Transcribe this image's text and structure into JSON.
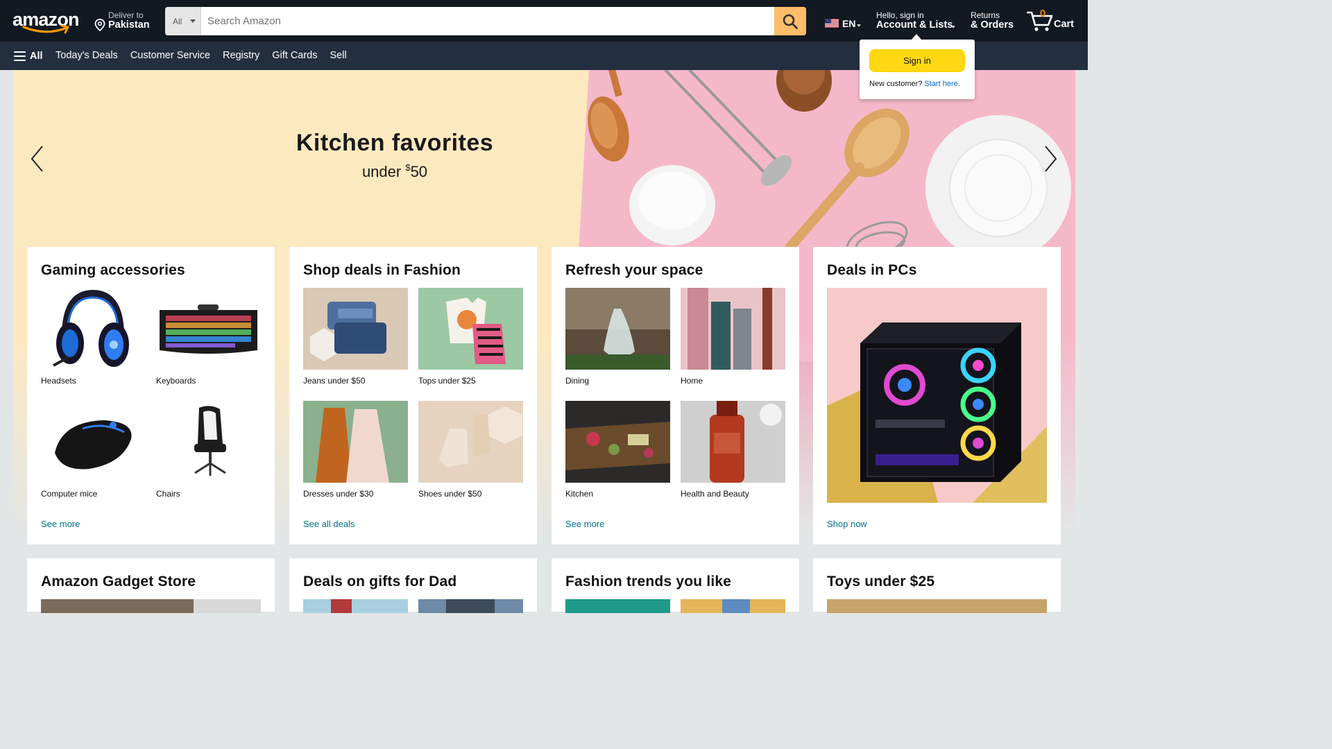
{
  "nav": {
    "logo": "amazon",
    "deliver_line1": "Deliver to",
    "deliver_line2": "Pakistan",
    "search_category": "All",
    "search_placeholder": "Search Amazon",
    "language": "EN",
    "account_line1": "Hello, sign in",
    "account_line2": "Account & Lists",
    "returns_line1": "Returns",
    "returns_line2": "& Orders",
    "cart_count": "0",
    "cart_label": "Cart",
    "all_label": "All",
    "links": [
      "Today's Deals",
      "Customer Service",
      "Registry",
      "Gift Cards",
      "Sell"
    ]
  },
  "flyout": {
    "signin_label": "Sign in",
    "new_customer": "New customer?",
    "start_here": "Start here."
  },
  "hero": {
    "title": "Kitchen favorites",
    "subtitle_prefix": "under ",
    "subtitle_currency": "$",
    "subtitle_amount": "50"
  },
  "cards": [
    {
      "title": "Gaming accessories",
      "items": [
        "Headsets",
        "Keyboards",
        "Computer mice",
        "Chairs"
      ],
      "link": "See more"
    },
    {
      "title": "Shop deals in Fashion",
      "items": [
        "Jeans under $50",
        "Tops under $25",
        "Dresses under $30",
        "Shoes under $50"
      ],
      "link": "See all deals"
    },
    {
      "title": "Refresh your space",
      "items": [
        "Dining",
        "Home",
        "Kitchen",
        "Health and Beauty"
      ],
      "link": "See more"
    },
    {
      "title": "Deals in PCs",
      "link": "Shop now"
    },
    {
      "title": "Amazon Gadget Store"
    },
    {
      "title": "Deals on gifts for Dad"
    },
    {
      "title": "Fashion trends you like"
    },
    {
      "title": "Toys under $25"
    }
  ],
  "colors": {
    "nav_top": "#131921",
    "nav_bottom": "#232f3e",
    "search_button": "#febd69",
    "signin_button": "#ffd814",
    "link": "#007185",
    "cart_count": "#f08804",
    "hero_cream": "#fde9c0",
    "hero_pink": "#f5b8c9"
  },
  "icons": [
    "map-pin-icon",
    "search-icon",
    "us-flag-icon",
    "cart-icon",
    "hamburger-icon",
    "chevron-left-icon",
    "chevron-right-icon"
  ]
}
